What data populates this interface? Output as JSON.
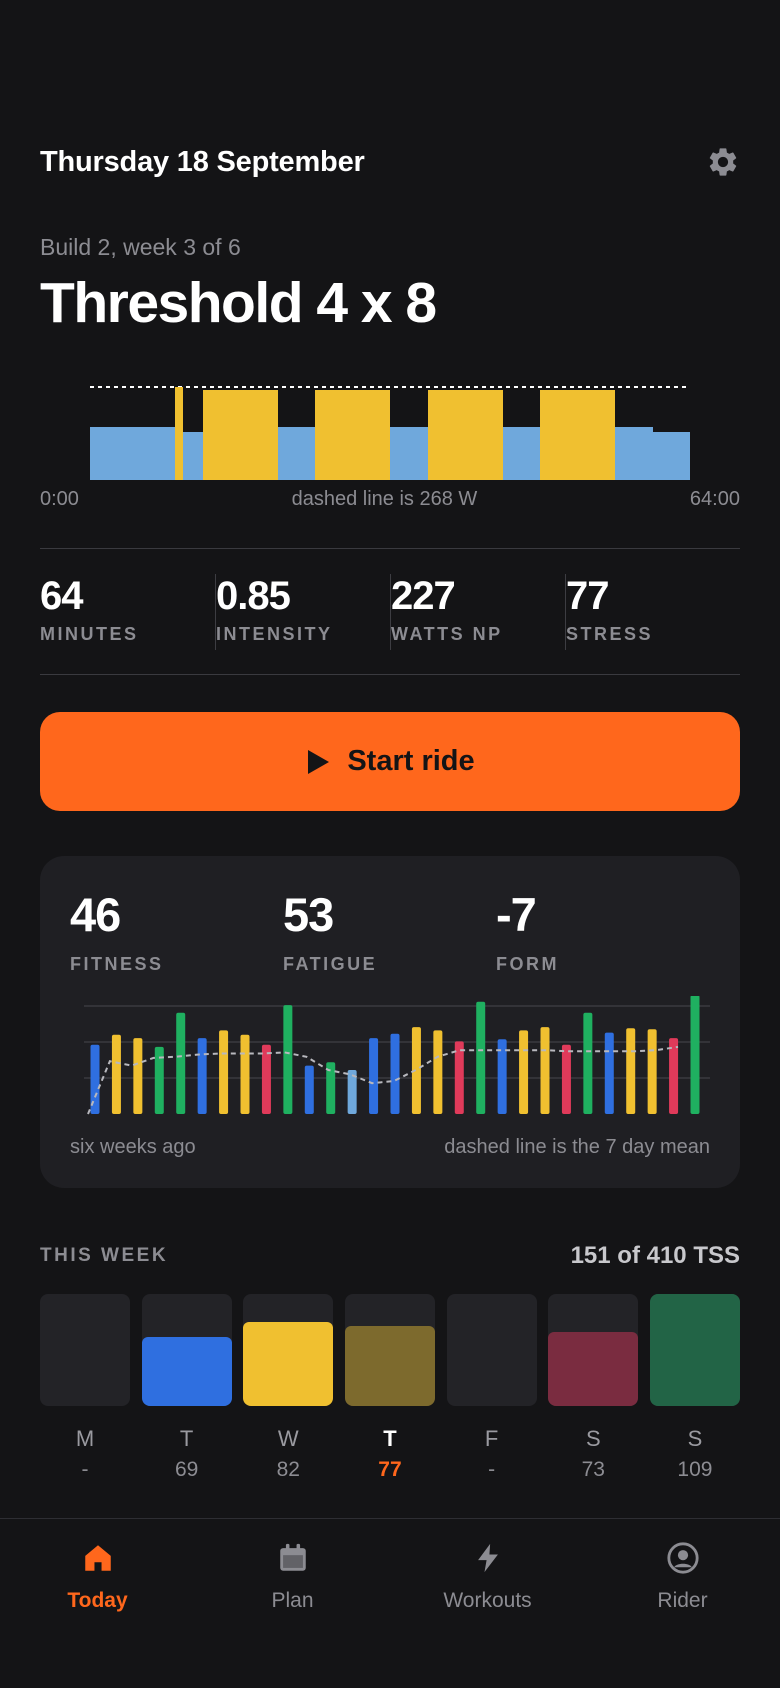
{
  "header": {
    "date": "Thursday 18 September",
    "settings_icon": "gear-icon"
  },
  "workout": {
    "block": "Build 2, week 3 of 6",
    "title": "Threshold 4 x 8",
    "profile": {
      "start_label": "0:00",
      "end_label": "64:00",
      "note": "dashed line is 268 W",
      "colors": {
        "recovery": "#6fa8dc",
        "threshold": "#f0c030"
      }
    }
  },
  "stats": [
    {
      "value": "64",
      "label": "MINUTES"
    },
    {
      "value": "0.85",
      "label": "INTENSITY"
    },
    {
      "value": "227",
      "label": "WATTS NP"
    },
    {
      "value": "77",
      "label": "STRESS"
    }
  ],
  "start_button": {
    "label": "Start ride",
    "icon": "play-icon",
    "color": "#ff671c"
  },
  "fitness": {
    "metrics": [
      {
        "value": "46",
        "label": "FITNESS"
      },
      {
        "value": "53",
        "label": "FATIGUE"
      },
      {
        "value": "-7",
        "label": "FORM"
      }
    ],
    "left_note": "six weeks ago",
    "right_note": "dashed line is the 7 day mean"
  },
  "chart_data": {
    "type": "bar",
    "bar_levels_as_fraction_of_chart_height": [
      0.63,
      0.72,
      0.69,
      0.61,
      0.92,
      0.69,
      0.76,
      0.72,
      0.63,
      0.99,
      0.44,
      0.47,
      0.4,
      0.69,
      0.73,
      0.79,
      0.76,
      0.66,
      1.02,
      0.68,
      0.76,
      0.79,
      0.63,
      0.92,
      0.74,
      0.78,
      0.77,
      0.69,
      1.08
    ],
    "bar_colors": [
      "#2f6fe0",
      "#f0c030",
      "#f0c030",
      "#1fb060",
      "#1fb060",
      "#2f6fe0",
      "#f0c030",
      "#f0c030",
      "#e03a5a",
      "#1fb060",
      "#2f6fe0",
      "#1fb060",
      "#6fa8dc",
      "#2f6fe0",
      "#2f6fe0",
      "#f0c030",
      "#f0c030",
      "#e03a5a",
      "#1fb060",
      "#2f6fe0",
      "#f0c030",
      "#f0c030",
      "#e03a5a",
      "#1fb060",
      "#2f6fe0",
      "#f0c030",
      "#f0c030",
      "#e03a5a",
      "#1fb060"
    ],
    "mean_line_as_fraction_of_chart_height": [
      0.0,
      0.48,
      0.44,
      0.51,
      0.52,
      0.54,
      0.55,
      0.55,
      0.55,
      0.56,
      0.52,
      0.4,
      0.36,
      0.28,
      0.3,
      0.4,
      0.52,
      0.58,
      0.58,
      0.58,
      0.58,
      0.58,
      0.57,
      0.57,
      0.57,
      0.57,
      0.58,
      0.61
    ],
    "grid": true
  },
  "week": {
    "title": "THIS WEEK",
    "summary": "151 of 410 TSS",
    "days": [
      {
        "letter": "M",
        "value": "-",
        "fill_fraction": 0,
        "color": "#232327",
        "today": false
      },
      {
        "letter": "T",
        "value": "69",
        "fill_fraction": 0.62,
        "color": "#2f6fe0",
        "today": false
      },
      {
        "letter": "W",
        "value": "82",
        "fill_fraction": 0.75,
        "color": "#f0c030",
        "today": false
      },
      {
        "letter": "T",
        "value": "77",
        "fill_fraction": 0.71,
        "color": "#7d6a2d",
        "today": true
      },
      {
        "letter": "F",
        "value": "-",
        "fill_fraction": 0,
        "color": "#232327",
        "today": false
      },
      {
        "letter": "S",
        "value": "73",
        "fill_fraction": 0.66,
        "color": "#7a2c40",
        "today": false
      },
      {
        "letter": "S",
        "value": "109",
        "fill_fraction": 1.0,
        "color": "#226446",
        "today": false
      }
    ]
  },
  "tabs": [
    {
      "label": "Today",
      "icon": "home-icon",
      "active": true
    },
    {
      "label": "Plan",
      "icon": "calendar-icon",
      "active": false
    },
    {
      "label": "Workouts",
      "icon": "lightning-icon",
      "active": false
    },
    {
      "label": "Rider",
      "icon": "user-circle-icon",
      "active": false
    }
  ]
}
